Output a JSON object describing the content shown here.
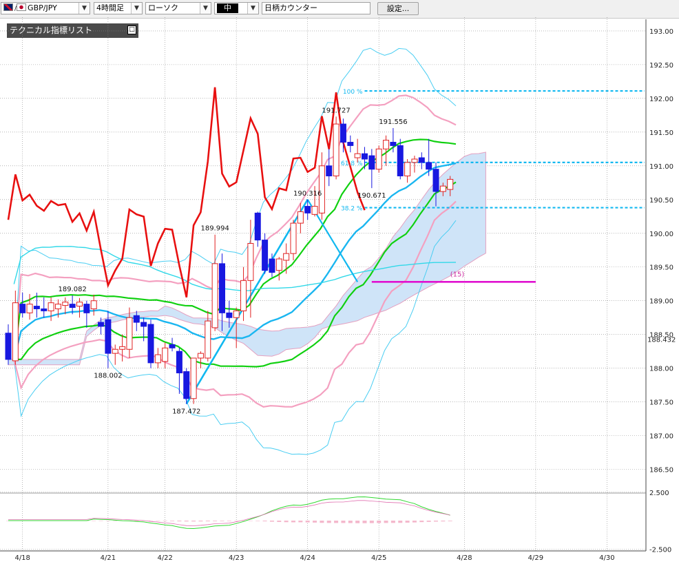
{
  "toolbar": {
    "pair": "GBP/JPY",
    "timeframe": "4時間足",
    "chart_style": "ローソク",
    "size": "中",
    "counter": "日柄カウンター",
    "settings": "設定..."
  },
  "panel": {
    "title": "テクニカル指標リスト"
  },
  "colors": {
    "bull_candle": "#e02020",
    "bear_candle": "#1818e0",
    "ma_short": "#1ab6f0",
    "ma_long": "#30d8e8",
    "bb_1sigma": "#10d010",
    "bb_2sigma": "#f4a0c0",
    "bb_3sigma": "#48cdf2",
    "rci": "#e81010",
    "cloud": "#cfe4f8",
    "target_line": "#e010d0",
    "fibo": "#10b8f0",
    "annotation": "#cc2aa0",
    "grid": "#8a8a8a"
  },
  "chart_data": {
    "type": "candlestick",
    "symbol": "GBP/JPY",
    "timeframe": "4時間足",
    "ylim": [
      186.2,
      193.05
    ],
    "y_ticks": [
      "193.00",
      "192.50",
      "192.00",
      "191.50",
      "191.00",
      "190.50",
      "190.00",
      "189.50",
      "189.00",
      "188.50",
      "188.00",
      "187.50",
      "187.00",
      "186.50"
    ],
    "current_price": "188.432",
    "x_labels": [
      {
        "label": "4/18",
        "index": 2
      },
      {
        "label": "4/21",
        "index": 14
      },
      {
        "label": "4/22",
        "index": 22
      },
      {
        "label": "4/23",
        "index": 32
      },
      {
        "label": "4/24",
        "index": 42
      },
      {
        "label": "4/25",
        "index": 52
      },
      {
        "label": "4/28",
        "index": 64
      },
      {
        "label": "4/29",
        "index": 74
      },
      {
        "label": "4/30",
        "index": 84
      }
    ],
    "candles": [
      {
        "o": 188.52,
        "h": 188.65,
        "l": 188.05,
        "c": 188.13
      },
      {
        "o": 188.11,
        "h": 189.15,
        "l": 188.05,
        "c": 188.97
      },
      {
        "o": 188.95,
        "h": 189.12,
        "l": 188.75,
        "c": 188.82
      },
      {
        "o": 188.82,
        "h": 189.1,
        "l": 188.72,
        "c": 188.95
      },
      {
        "o": 188.92,
        "h": 189.12,
        "l": 188.75,
        "c": 188.88
      },
      {
        "o": 188.88,
        "h": 189.05,
        "l": 188.75,
        "c": 188.85
      },
      {
        "o": 188.85,
        "h": 189.05,
        "l": 188.7,
        "c": 188.97
      },
      {
        "o": 188.88,
        "h": 189.02,
        "l": 188.75,
        "c": 188.95
      },
      {
        "o": 188.93,
        "h": 189.05,
        "l": 188.8,
        "c": 188.98
      },
      {
        "o": 188.95,
        "h": 189.08,
        "l": 188.8,
        "c": 188.9
      },
      {
        "o": 188.92,
        "h": 189.04,
        "l": 188.75,
        "c": 188.98
      },
      {
        "o": 188.95,
        "h": 189.0,
        "l": 188.6,
        "c": 188.82
      },
      {
        "o": 188.88,
        "h": 189.09,
        "l": 188.78,
        "c": 189.0
      },
      {
        "o": 188.68,
        "h": 188.75,
        "l": 188.5,
        "c": 188.62
      },
      {
        "o": 188.72,
        "h": 188.85,
        "l": 188.0,
        "c": 188.22
      },
      {
        "o": 188.22,
        "h": 188.35,
        "l": 188.05,
        "c": 188.28
      },
      {
        "o": 188.28,
        "h": 188.5,
        "l": 188.1,
        "c": 188.32
      },
      {
        "o": 188.28,
        "h": 188.9,
        "l": 188.15,
        "c": 188.75
      },
      {
        "o": 188.78,
        "h": 188.85,
        "l": 188.55,
        "c": 188.68
      },
      {
        "o": 188.68,
        "h": 188.75,
        "l": 188.4,
        "c": 188.62
      },
      {
        "o": 188.65,
        "h": 188.72,
        "l": 188.0,
        "c": 188.08
      },
      {
        "o": 188.08,
        "h": 188.3,
        "l": 188.0,
        "c": 188.2
      },
      {
        "o": 188.1,
        "h": 188.38,
        "l": 188.0,
        "c": 188.3
      },
      {
        "o": 188.35,
        "h": 188.45,
        "l": 188.25,
        "c": 188.3
      },
      {
        "o": 188.25,
        "h": 188.3,
        "l": 187.62,
        "c": 187.93
      },
      {
        "o": 187.95,
        "h": 188.0,
        "l": 187.47,
        "c": 187.55
      },
      {
        "o": 187.55,
        "h": 188.15,
        "l": 187.47,
        "c": 188.15
      },
      {
        "o": 188.15,
        "h": 188.25,
        "l": 188.0,
        "c": 188.22
      },
      {
        "o": 188.15,
        "h": 188.85,
        "l": 188.1,
        "c": 188.7
      },
      {
        "o": 188.6,
        "h": 189.98,
        "l": 188.55,
        "c": 189.55
      },
      {
        "o": 189.55,
        "h": 189.7,
        "l": 188.55,
        "c": 188.82
      },
      {
        "o": 188.82,
        "h": 189.0,
        "l": 188.6,
        "c": 188.75
      },
      {
        "o": 188.75,
        "h": 188.9,
        "l": 188.3,
        "c": 188.85
      },
      {
        "o": 188.85,
        "h": 189.5,
        "l": 188.7,
        "c": 189.3
      },
      {
        "o": 189.3,
        "h": 190.2,
        "l": 188.75,
        "c": 189.85
      },
      {
        "o": 190.3,
        "h": 190.32,
        "l": 189.8,
        "c": 189.9
      },
      {
        "o": 189.9,
        "h": 190.0,
        "l": 189.4,
        "c": 189.45
      },
      {
        "o": 189.62,
        "h": 189.7,
        "l": 189.35,
        "c": 189.42
      },
      {
        "o": 189.45,
        "h": 189.65,
        "l": 189.3,
        "c": 189.62
      },
      {
        "o": 189.6,
        "h": 189.85,
        "l": 189.4,
        "c": 189.7
      },
      {
        "o": 189.7,
        "h": 190.2,
        "l": 189.6,
        "c": 190.15
      },
      {
        "o": 190.15,
        "h": 190.45,
        "l": 190.0,
        "c": 190.32
      },
      {
        "o": 190.4,
        "h": 190.5,
        "l": 190.2,
        "c": 190.3
      },
      {
        "o": 190.28,
        "h": 190.7,
        "l": 190.25,
        "c": 190.4
      },
      {
        "o": 190.3,
        "h": 191.2,
        "l": 190.2,
        "c": 191.0
      },
      {
        "o": 191.0,
        "h": 191.25,
        "l": 190.7,
        "c": 190.85
      },
      {
        "o": 190.85,
        "h": 191.73,
        "l": 190.8,
        "c": 191.62
      },
      {
        "o": 191.62,
        "h": 191.7,
        "l": 191.2,
        "c": 191.35
      },
      {
        "o": 191.35,
        "h": 191.45,
        "l": 191.2,
        "c": 191.3
      },
      {
        "o": 191.12,
        "h": 191.4,
        "l": 191.05,
        "c": 191.18
      },
      {
        "o": 191.18,
        "h": 191.28,
        "l": 190.95,
        "c": 191.1
      },
      {
        "o": 191.15,
        "h": 191.25,
        "l": 190.67,
        "c": 190.95
      },
      {
        "o": 190.95,
        "h": 191.3,
        "l": 190.9,
        "c": 191.25
      },
      {
        "o": 191.25,
        "h": 191.45,
        "l": 191.0,
        "c": 191.38
      },
      {
        "o": 191.35,
        "h": 191.56,
        "l": 191.2,
        "c": 191.3
      },
      {
        "o": 191.3,
        "h": 191.4,
        "l": 190.8,
        "c": 190.85
      },
      {
        "o": 190.85,
        "h": 191.1,
        "l": 190.75,
        "c": 191.05
      },
      {
        "o": 191.05,
        "h": 191.15,
        "l": 190.9,
        "c": 191.1
      },
      {
        "o": 191.12,
        "h": 191.2,
        "l": 190.95,
        "c": 191.05
      },
      {
        "o": 191.05,
        "h": 191.4,
        "l": 190.85,
        "c": 190.95
      },
      {
        "o": 190.95,
        "h": 191.05,
        "l": 190.4,
        "c": 190.62
      },
      {
        "o": 190.62,
        "h": 190.75,
        "l": 190.55,
        "c": 190.7
      },
      {
        "o": 190.65,
        "h": 190.85,
        "l": 190.55,
        "c": 190.8
      }
    ],
    "annotations": [
      {
        "text": "189.082",
        "type": "high"
      },
      {
        "text": "188.002",
        "type": "low"
      },
      {
        "text": "187.472",
        "type": "low"
      },
      {
        "text": "189.994",
        "type": "high"
      },
      {
        "text": "190.316",
        "type": "high"
      },
      {
        "text": "191.727",
        "type": "high"
      },
      {
        "text": "191.556",
        "type": "high"
      },
      {
        "text": "190.671",
        "type": "low"
      }
    ],
    "fibonacci": [
      {
        "label": "100 %",
        "price": 192.11
      },
      {
        "label": "61.8 %",
        "price": 191.05
      },
      {
        "label": "38.2 %",
        "price": 190.38
      }
    ],
    "day_counter": {
      "label": "(15)",
      "price": 189.28
    },
    "oscillator": {
      "y_ticks": [
        "2.500",
        "-2.500"
      ]
    }
  }
}
